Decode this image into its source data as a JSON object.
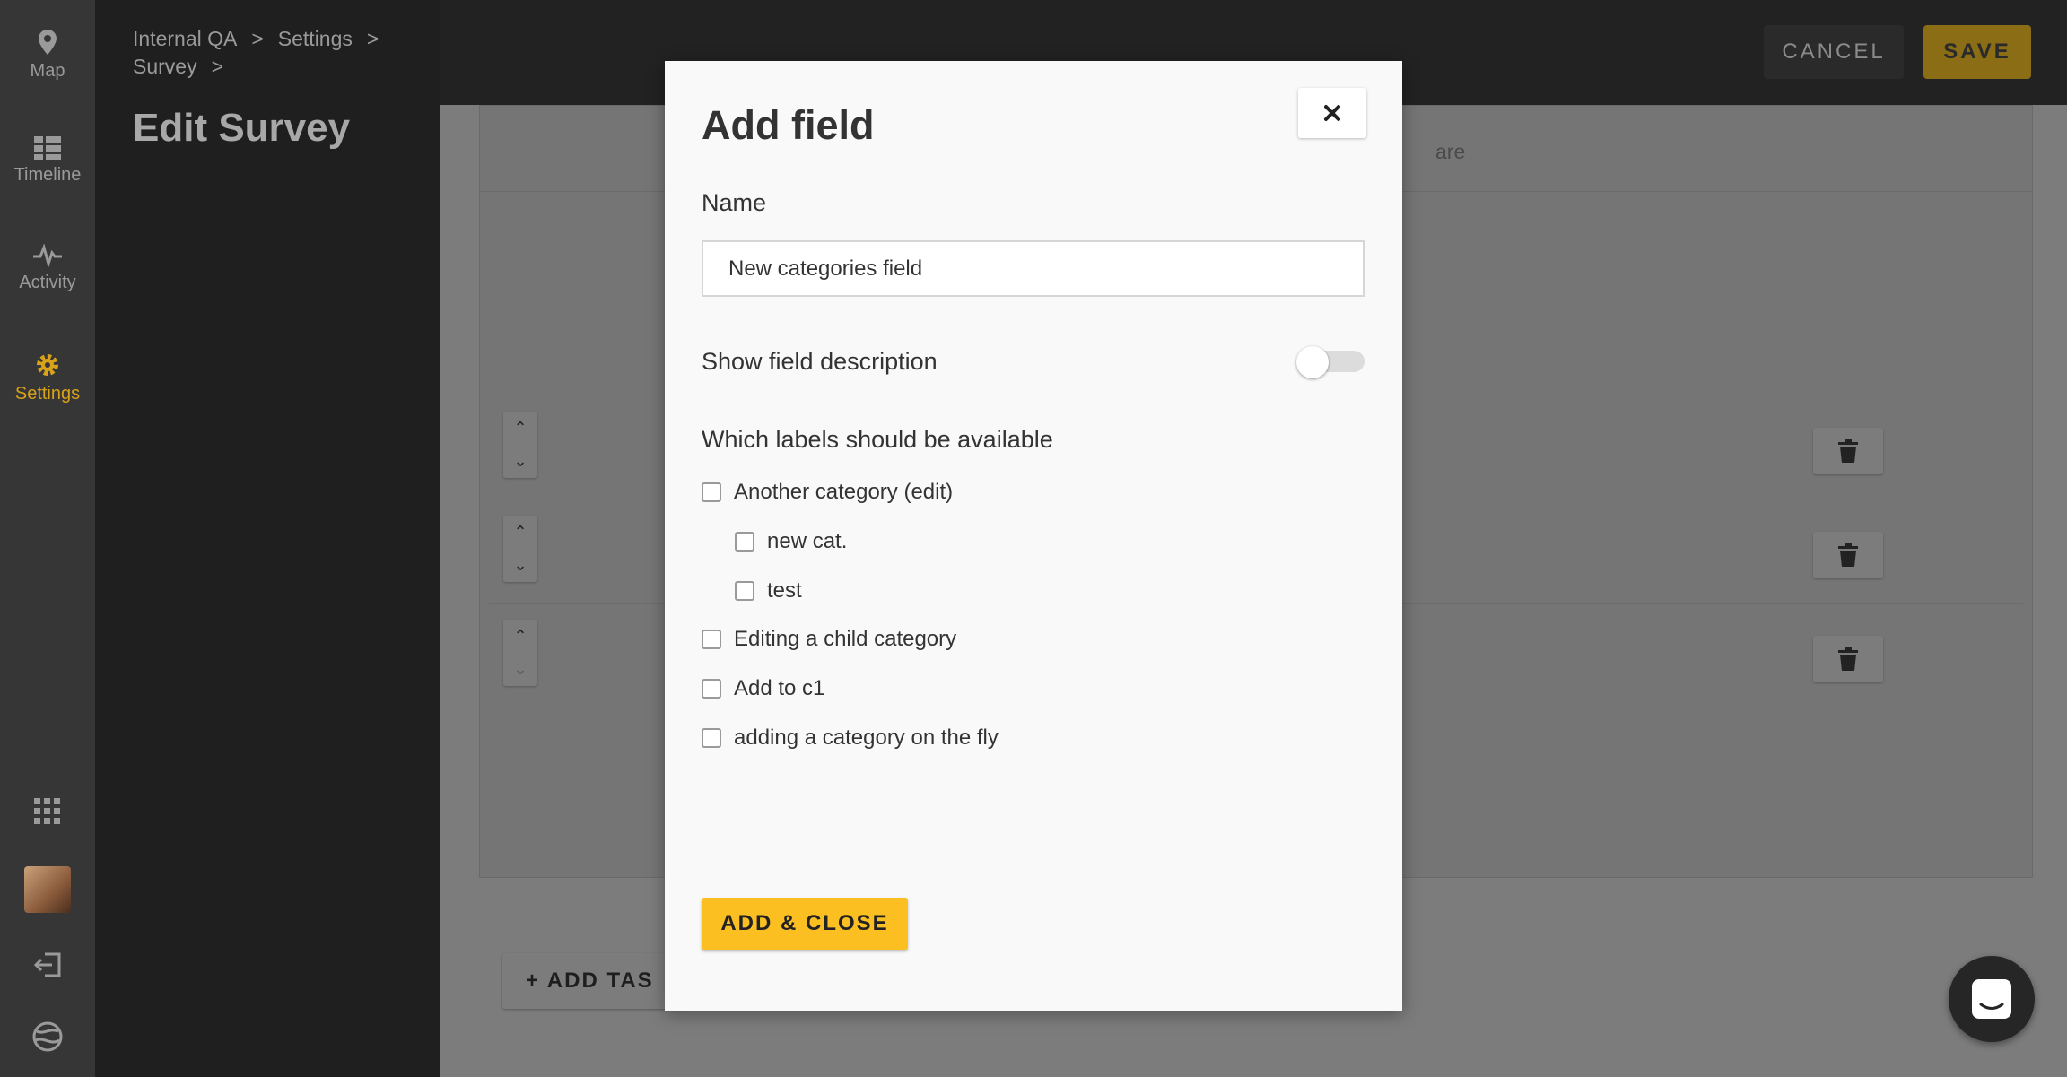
{
  "rail": {
    "items": [
      {
        "label": "Map",
        "icon": "map-pin-icon"
      },
      {
        "label": "Timeline",
        "icon": "timeline-icon"
      },
      {
        "label": "Activity",
        "icon": "activity-icon"
      },
      {
        "label": "Settings",
        "icon": "gear-icon",
        "active": true
      }
    ],
    "bottom_icons": [
      "grid-icon",
      "avatar",
      "logout-icon",
      "globe-icon"
    ]
  },
  "sidebar": {
    "breadcrumbs": [
      "Internal QA",
      "Settings",
      "Survey"
    ],
    "title": "Edit Survey"
  },
  "topbar": {
    "cancel_label": "CANCEL",
    "save_label": "SAVE"
  },
  "background": {
    "header_partial_text": "are",
    "add_task_label": "ADD TAS"
  },
  "modal": {
    "title": "Add field",
    "name_label": "Name",
    "name_value": "New categories field",
    "show_description_label": "Show field description",
    "show_description_on": false,
    "labels_heading": "Which labels should be available",
    "categories": [
      {
        "label": "Another category (edit)",
        "checked": false
      },
      {
        "label": "new cat.",
        "checked": false,
        "child": true
      },
      {
        "label": "test",
        "checked": false,
        "child": true
      },
      {
        "label": "Editing a child category",
        "checked": false
      },
      {
        "label": "Add to c1",
        "checked": false
      },
      {
        "label": "adding a category on the fly",
        "checked": false
      }
    ],
    "submit_label": "ADD & CLOSE"
  },
  "colors": {
    "accent": "#fcbf22",
    "active_nav": "#d8a21a",
    "modal_bg": "#f9f9f9"
  }
}
